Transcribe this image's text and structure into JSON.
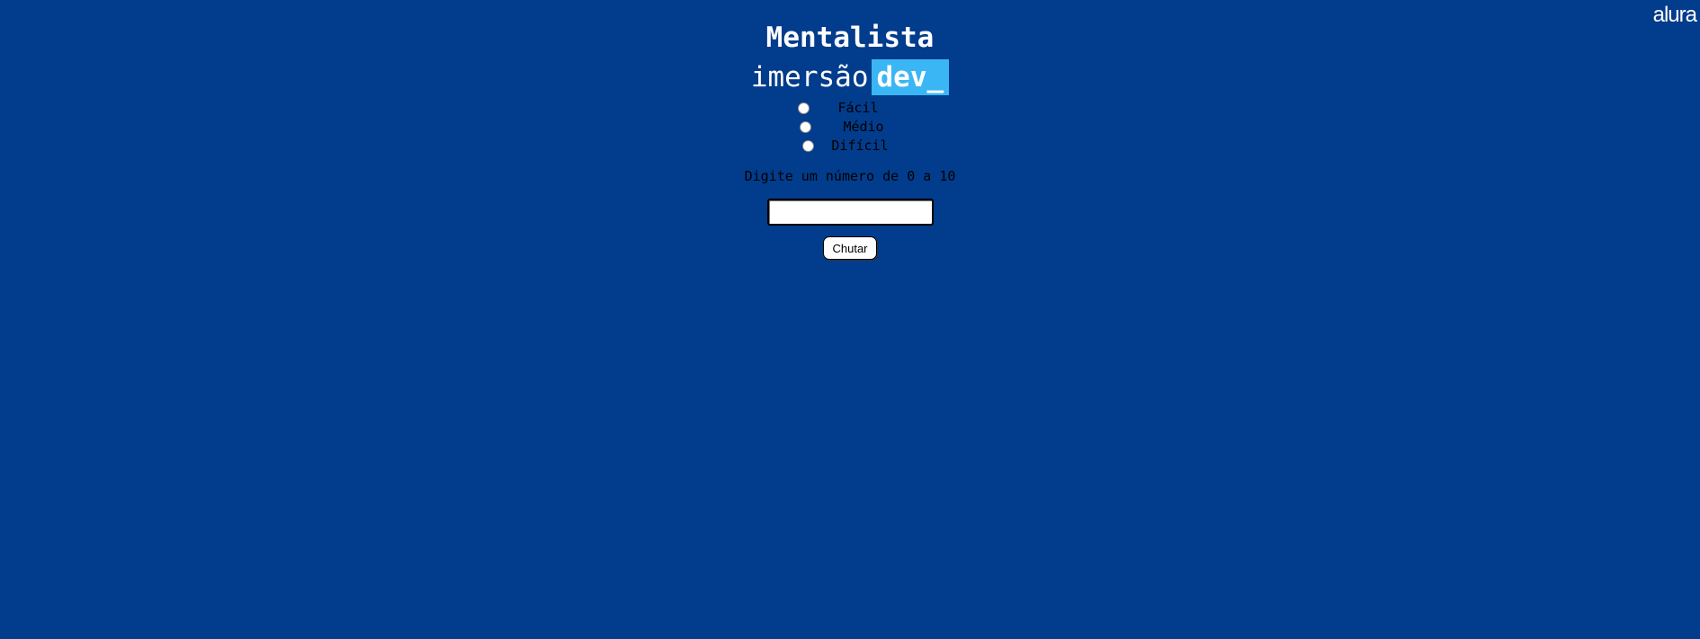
{
  "brand": "alura",
  "title": "Mentalista",
  "logo": {
    "part1": "imersão",
    "part2": "dev_"
  },
  "levels": [
    {
      "label": "Fácil"
    },
    {
      "label": "Médio"
    },
    {
      "label": "Difícil"
    }
  ],
  "prompt": "Digite um número de 0 a 10",
  "input": {
    "value": "",
    "placeholder": ""
  },
  "button_label": "Chutar",
  "colors": {
    "background": "#023c8c",
    "logo_accent": "#3bb6f5",
    "text_white": "#ffffff",
    "text_dark": "#000000"
  }
}
